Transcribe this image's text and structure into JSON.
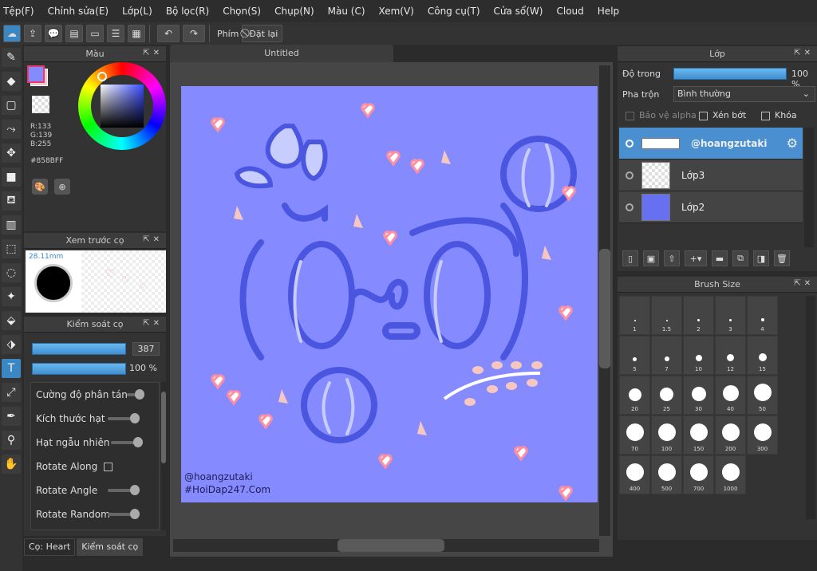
{
  "menu": [
    "Tệp(F)",
    "Chỉnh sửa(E)",
    "Lớp(L)",
    "Bộ lọc(R)",
    "Chọn(S)",
    "Chụp(N)",
    "Màu (C)",
    "Xem(V)",
    "Công cụ(T)",
    "Cửa sổ(W)",
    "Cloud",
    "Help"
  ],
  "toolbar": {
    "key_label": "Phím",
    "reset_label": "Đặt lại"
  },
  "color": {
    "title": "Màu",
    "r": "R:133",
    "g": "G:139",
    "b": "B:255",
    "hex": "#858BFF",
    "fg": "#858BFF"
  },
  "preview": {
    "title": "Xem trước cọ",
    "size": "28.11mm"
  },
  "brush_control": {
    "title": "Kiểm soát cọ",
    "size_value": "387",
    "opacity_value": "100 %",
    "rows": [
      "Cường độ phân tán",
      "Kích thước hạt",
      "Hạt ngẫu nhiên",
      "Rotate Along",
      "Rotate Angle",
      "Rotate Random"
    ]
  },
  "tabs": {
    "brush": "Cọ: Heart",
    "control": "Kiểm soát cọ"
  },
  "canvas": {
    "title": "Untitled",
    "watermark1": "@hoangzutaki",
    "watermark2": "#HoiDap247.Com",
    "bg": "#858BFF"
  },
  "layers": {
    "title": "Lớp",
    "opacity_label": "Độ trong",
    "opacity_value": "100 %",
    "blend_label": "Pha trộn",
    "blend_value": "Bình thường",
    "protect_alpha": "Bảo vệ alpha",
    "clipping": "Xén bớt",
    "lock": "Khóa",
    "items": [
      {
        "name": "@hoangzutaki"
      },
      {
        "name": "Lớp3"
      },
      {
        "name": "Lớp2"
      }
    ]
  },
  "brush_size": {
    "title": "Brush Size",
    "sizes": [
      "1",
      "1.5",
      "2",
      "3",
      "4",
      "5",
      "7",
      "10",
      "12",
      "15",
      "20",
      "25",
      "30",
      "40",
      "50",
      "70",
      "100",
      "150",
      "200",
      "300",
      "400",
      "500",
      "700",
      "1000"
    ]
  }
}
